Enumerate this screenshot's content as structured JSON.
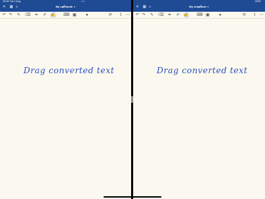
{
  "status": {
    "time": "09:06",
    "date": "Tue 1 Aug",
    "dots": "•••",
    "battery": "100%"
  },
  "panes": [
    {
      "notebook_title": "My notebook",
      "handwritten_text": "Drag converted text"
    },
    {
      "notebook_title": "My notebook",
      "handwritten_text": "Drag converted text"
    }
  ],
  "colors": {
    "brand": "#1f4b95",
    "ink": "#2a4fbf",
    "paper": "#fbf9ef"
  }
}
